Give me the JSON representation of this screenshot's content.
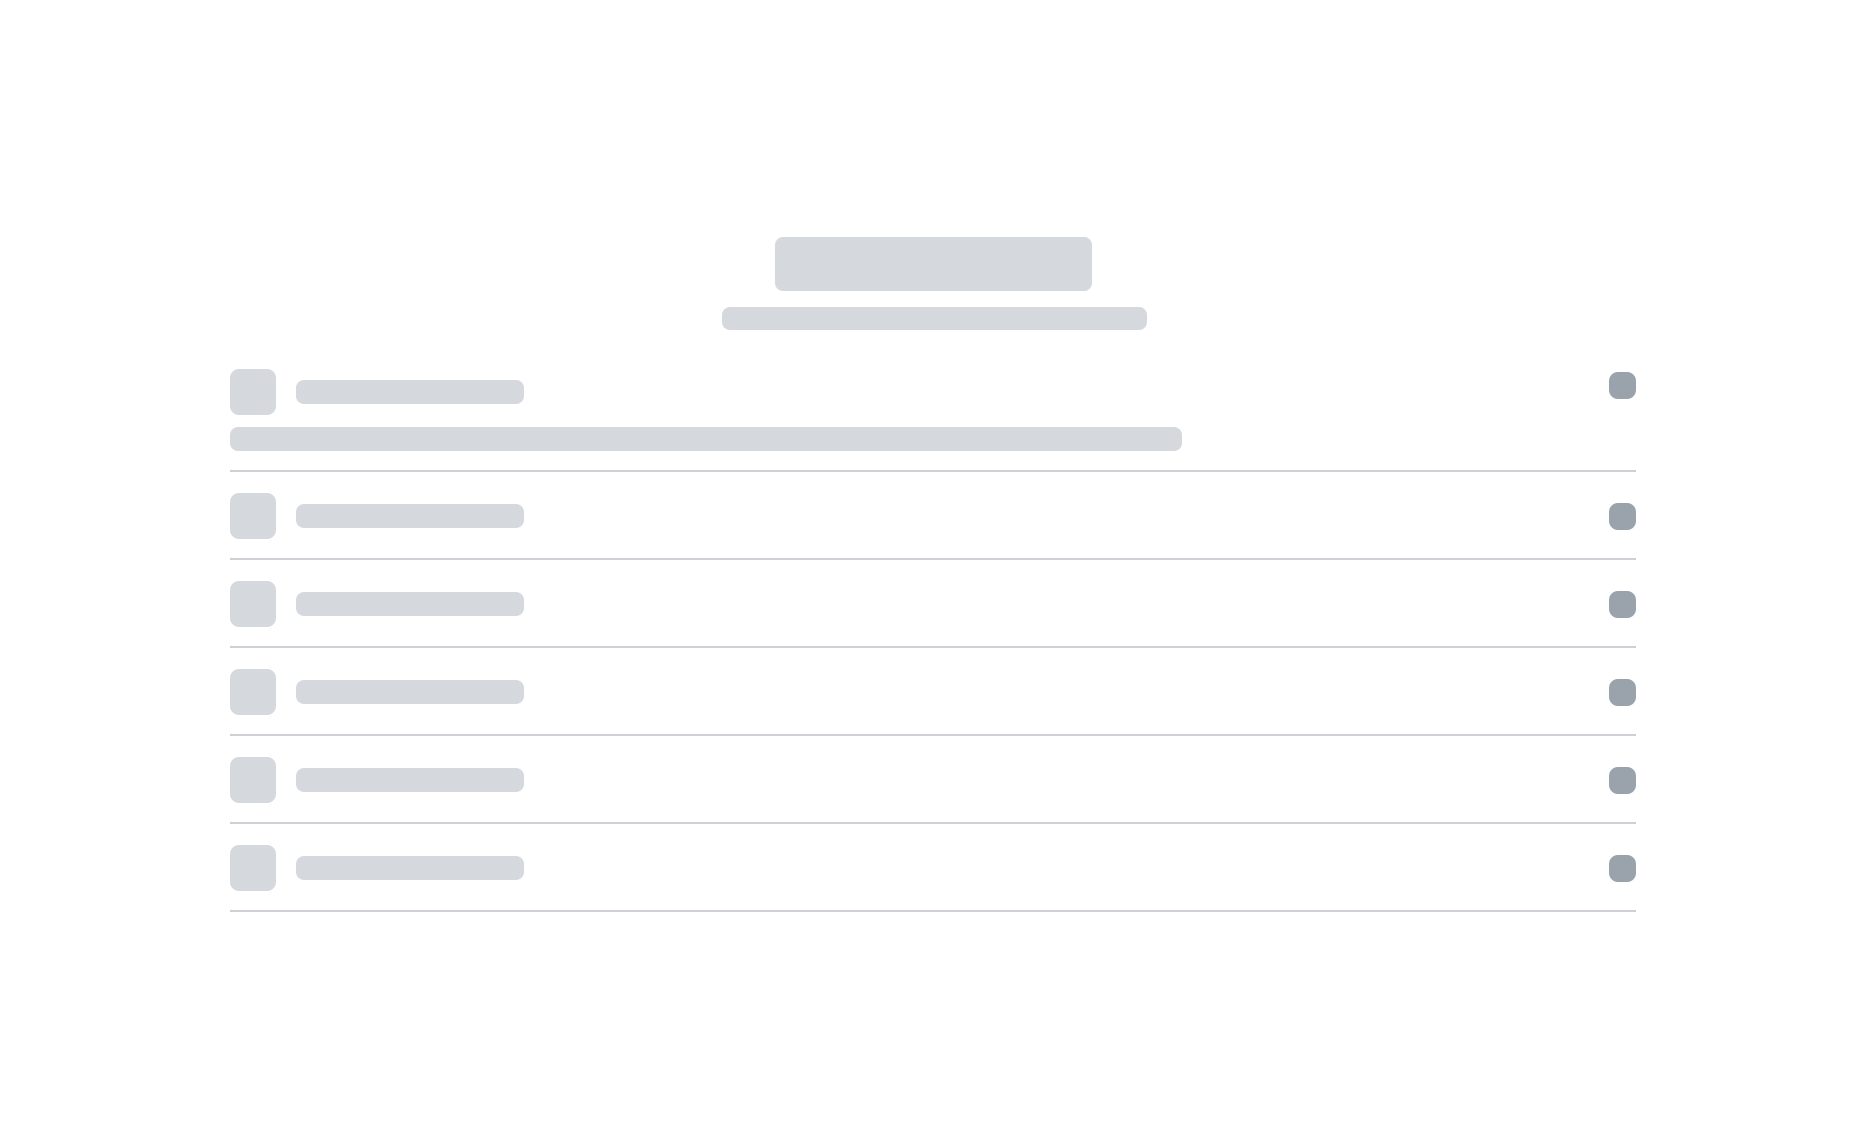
{
  "page": {
    "title": "",
    "subtitle": ""
  },
  "colors": {
    "skeleton": "#d5d9dd",
    "toggle": "#9aa3ac",
    "divider": "#cdd1d5",
    "background": "#ffffff"
  },
  "items": [
    {
      "label": "",
      "description": "",
      "expanded": true
    },
    {
      "label": "",
      "expanded": false
    },
    {
      "label": "",
      "expanded": false
    },
    {
      "label": "",
      "expanded": false
    },
    {
      "label": "",
      "expanded": false
    },
    {
      "label": "",
      "expanded": false
    }
  ]
}
